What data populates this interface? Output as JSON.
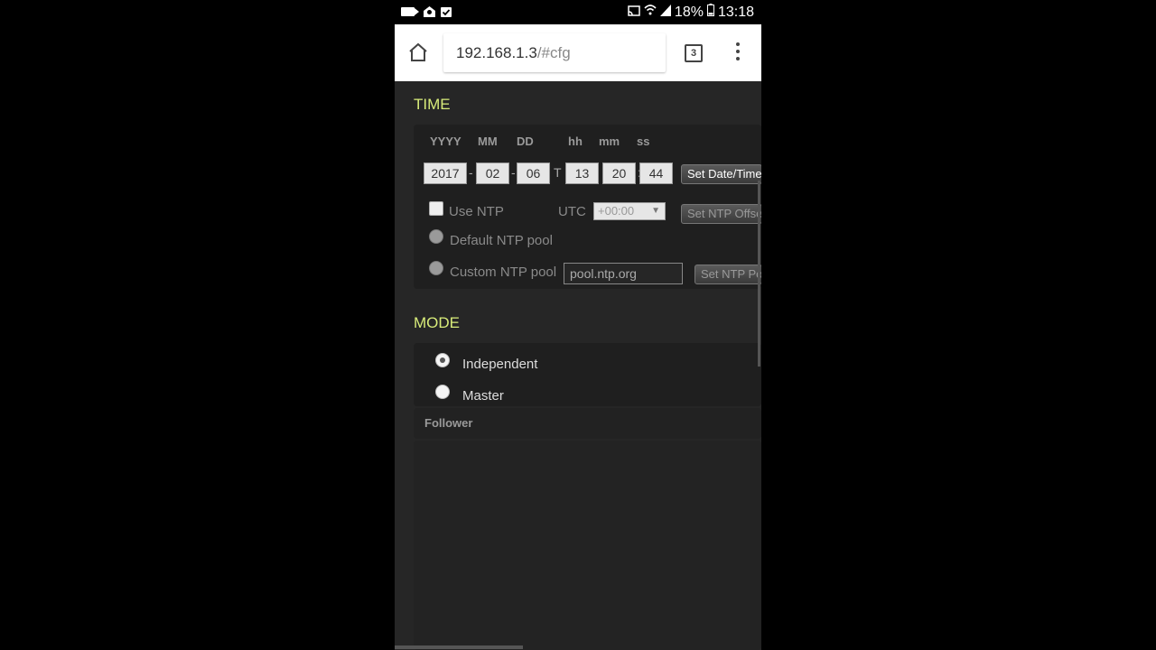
{
  "status_bar": {
    "battery": "18%",
    "time": "13:18"
  },
  "browser": {
    "url_host": "192.168.1.3",
    "url_path": "/#cfg",
    "tab_count": "3"
  },
  "time_section": {
    "title": "TIME",
    "labels": {
      "year": "YYYY",
      "month": "MM",
      "day": "DD",
      "hour": "hh",
      "minute": "mm",
      "second": "ss"
    },
    "values": {
      "year": "2017",
      "month": "02",
      "day": "06",
      "hour": "13",
      "minute": "20",
      "second": "44"
    },
    "date_sep": "-",
    "t_sep": "T",
    "time_sep": ":",
    "set_datetime_label": "Set Date/Time",
    "use_ntp_label": "Use NTP",
    "utc_label": "UTC",
    "utc_offset": "+00:00",
    "set_ntp_offset_label": "Set NTP Offset",
    "default_pool_label": "Default NTP pool",
    "custom_pool_label": "Custom NTP pool",
    "custom_pool_value": "pool.ntp.org",
    "set_ntp_pool_label": "Set NTP Pool"
  },
  "mode_section": {
    "title": "MODE",
    "options": [
      {
        "label": "Independent",
        "checked": true
      },
      {
        "label": "Master",
        "checked": false
      }
    ],
    "follower_label": "Follower"
  }
}
